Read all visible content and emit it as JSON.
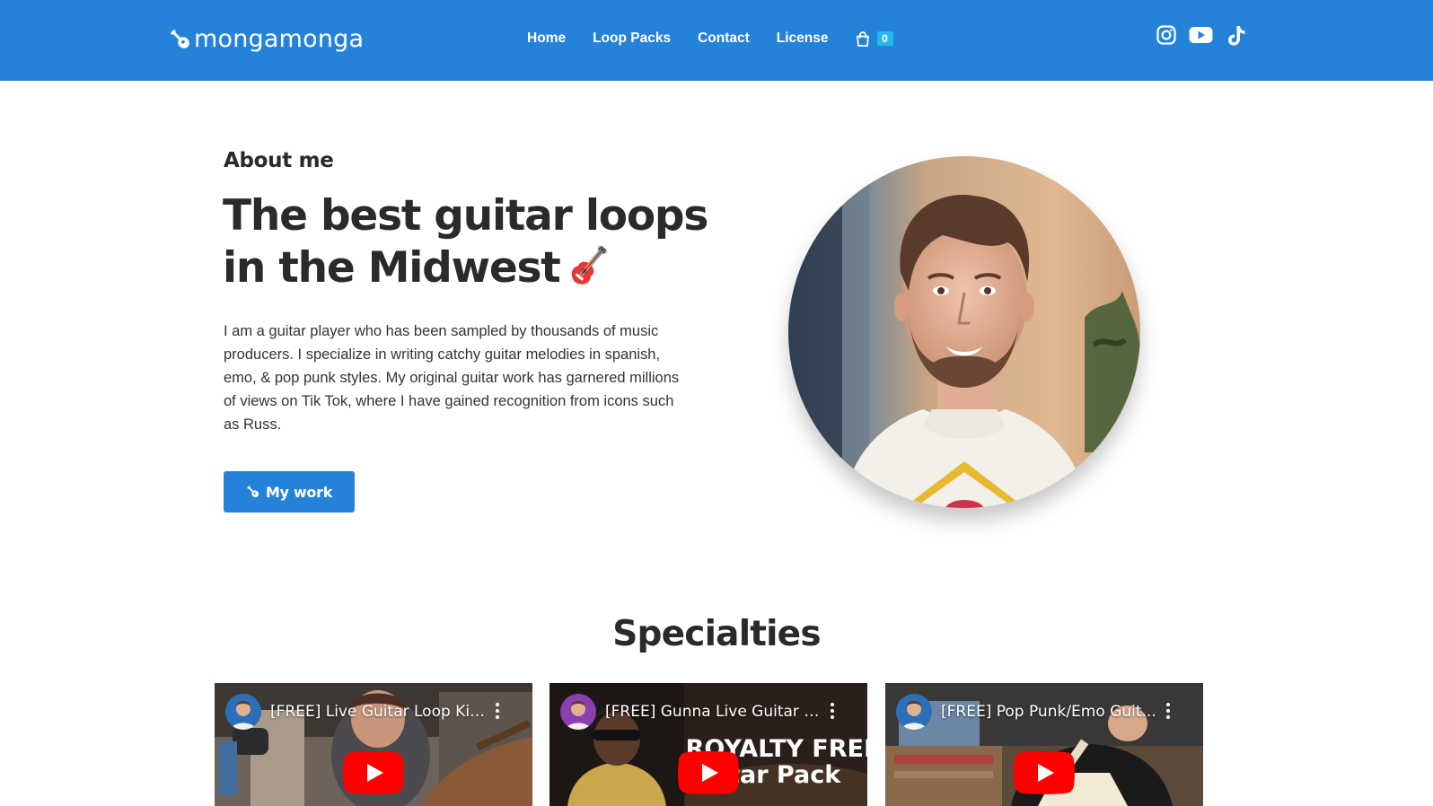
{
  "header": {
    "logo_text": "mongamonga",
    "nav": [
      {
        "label": "Home"
      },
      {
        "label": "Loop Packs"
      },
      {
        "label": "Contact"
      },
      {
        "label": "License"
      }
    ],
    "cart_count": "0",
    "social_icons": [
      "instagram-icon",
      "youtube-icon",
      "tiktok-icon"
    ],
    "brand_color": "#2482d9",
    "cart_badge_color": "#27b8ef"
  },
  "hero": {
    "eyebrow": "About me",
    "headline_line1": "The best guitar loops",
    "headline_line2": "in the Midwest",
    "headline_emoji": "guitar-emoji-icon",
    "bio": "I am a guitar player who has been sampled by thousands of music producers. I specialize in writing catchy guitar melodies in spanish, emo, & pop punk styles. My original guitar work has garnered millions of views on Tik Tok, where I have gained recognition from icons such as Russ.",
    "cta_label": "My work"
  },
  "specialties": {
    "title": "Specialties",
    "videos": [
      {
        "title": "[FREE] Live Guitar Loop Kit ..."
      },
      {
        "title": "[FREE] Gunna Live Guitar L..."
      },
      {
        "title": "[FREE] Pop Punk/Emo Guit..."
      }
    ],
    "overlay_text": [
      "ROYALTY FREE",
      "itar Pack"
    ]
  }
}
